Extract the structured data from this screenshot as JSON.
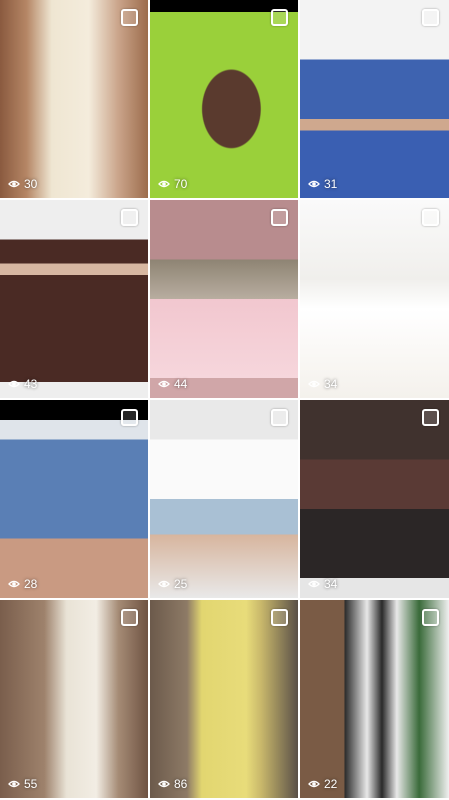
{
  "grid": {
    "tiles": [
      {
        "views": "30"
      },
      {
        "views": "70"
      },
      {
        "views": "31"
      },
      {
        "views": "43"
      },
      {
        "views": "44"
      },
      {
        "views": "34"
      },
      {
        "views": "28"
      },
      {
        "views": "25"
      },
      {
        "views": "34"
      },
      {
        "views": "55"
      },
      {
        "views": "86"
      },
      {
        "views": "22"
      }
    ]
  },
  "icons": {
    "views": "eye-icon",
    "select": "checkbox-icon"
  }
}
